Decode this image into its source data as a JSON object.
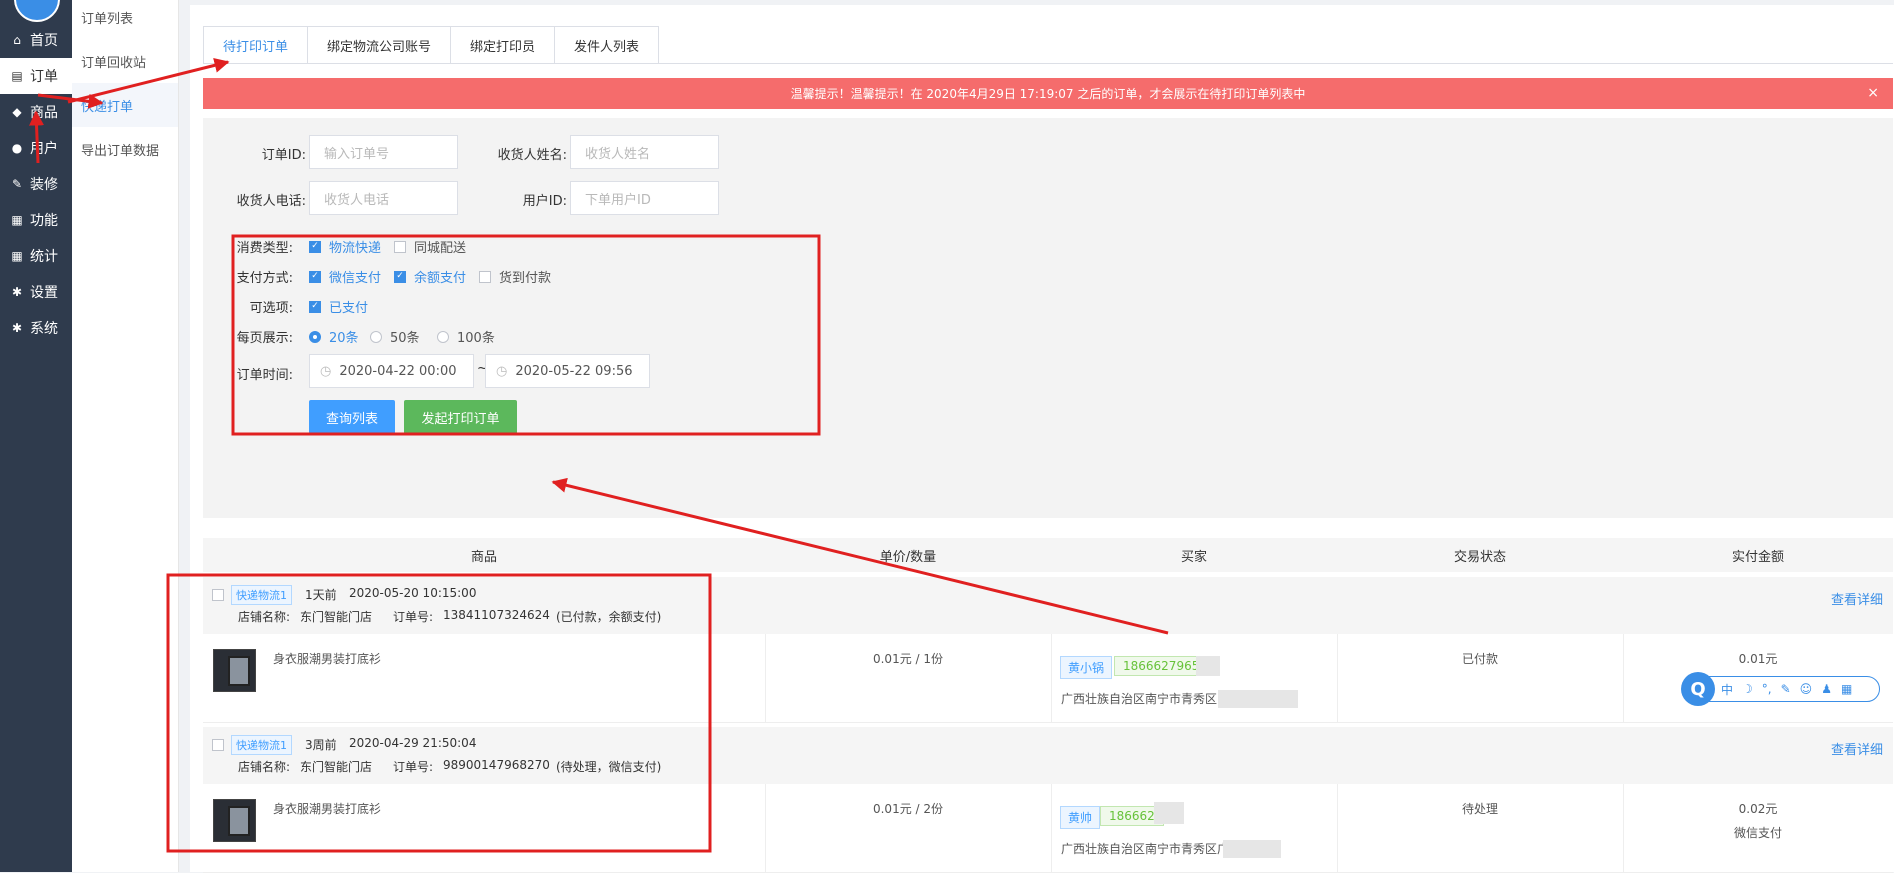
{
  "nav": {
    "items": [
      {
        "icon": "home-icon",
        "label": "首页"
      },
      {
        "icon": "order-icon",
        "label": "订单",
        "active": true
      },
      {
        "icon": "bag-icon",
        "label": "商品"
      },
      {
        "icon": "user-icon",
        "label": "用户"
      },
      {
        "icon": "paint-icon",
        "label": "装修"
      },
      {
        "icon": "grid-icon",
        "label": "功能"
      },
      {
        "icon": "grid-icon",
        "label": "统计"
      },
      {
        "icon": "gear-icon",
        "label": "设置"
      },
      {
        "icon": "gear-icon",
        "label": "系统"
      }
    ]
  },
  "subnav": {
    "items": [
      "订单列表",
      "订单回收站",
      "快递打单",
      "导出订单数据"
    ],
    "active_index": 2
  },
  "tabs": [
    "待打印订单",
    "绑定物流公司账号",
    "绑定打印员",
    "发件人列表"
  ],
  "active_tab": 0,
  "alert": {
    "text": "温馨提示！温馨提示！在 2020年4月29日 17:19:07 之后的订单，才会展示在待打印订单列表中",
    "close": "×"
  },
  "filters": {
    "order_id": {
      "label": "订单ID:",
      "placeholder": "输入订单号"
    },
    "receiver_name": {
      "label": "收货人姓名:",
      "placeholder": "收货人姓名"
    },
    "receiver_phone": {
      "label": "收货人电话:",
      "placeholder": "收货人电话"
    },
    "user_id": {
      "label": "用户ID:",
      "placeholder": "下单用户ID"
    },
    "consume_type": {
      "label": "消费类型:",
      "options": [
        {
          "text": "物流快递",
          "checked": true
        },
        {
          "text": "同城配送",
          "checked": false
        }
      ]
    },
    "pay_method": {
      "label": "支付方式:",
      "options": [
        {
          "text": "微信支付",
          "checked": true
        },
        {
          "text": "余额支付",
          "checked": true
        },
        {
          "text": "货到付款",
          "checked": false
        }
      ]
    },
    "optional": {
      "label": "可选项:",
      "options": [
        {
          "text": "已支付",
          "checked": true
        }
      ]
    },
    "per_page": {
      "label": "每页展示:",
      "options": [
        {
          "text": "20条",
          "checked": true
        },
        {
          "text": "50条",
          "checked": false
        },
        {
          "text": "100条",
          "checked": false
        }
      ]
    },
    "order_time": {
      "label": "订单时间:",
      "start": "2020-04-22 00:00",
      "end": "2020-05-22 09:56",
      "sep": "~"
    },
    "query_button": "查询列表",
    "print_button": "发起打印订单"
  },
  "table": {
    "headers": [
      "商品",
      "单价/数量",
      "买家",
      "交易状态",
      "实付金额"
    ],
    "orders": [
      {
        "tag": "快递物流1",
        "ago": "1天前",
        "time": "2020-05-20 10:15:00",
        "store_label": "店铺名称:",
        "store": "东门智能门店",
        "no_label": "订单号:",
        "no": "13841107324624",
        "pay_info": "(已付款，余额支付)",
        "product": "身衣服潮男装打底衫",
        "price_qty": "0.01元 / 1份",
        "buyer_name": "黄小锅",
        "buyer_phone": "1866627965",
        "address": "广西壮族自治区南宁市青秀区",
        "status": "已付款",
        "amount": "0.01元",
        "pay": "余额支付",
        "detail": "查看详细"
      },
      {
        "tag": "快递物流1",
        "ago": "3周前",
        "time": "2020-04-29 21:50:04",
        "store_label": "店铺名称:",
        "store": "东门智能门店",
        "no_label": "订单号:",
        "no": "98900147968270",
        "pay_info": "(待处理，微信支付)",
        "product": "身衣服潮男装打底衫",
        "price_qty": "0.01元 / 2份",
        "buyer_name": "黄帅",
        "buyer_phone": "186662",
        "address": "广西壮族自治区南宁市青秀区广",
        "status": "待处理",
        "amount": "0.02元",
        "pay": "微信支付",
        "detail": "查看详细"
      }
    ]
  },
  "ime": {
    "q": "Q",
    "items": [
      "中",
      "☽",
      "°,",
      "✎",
      "☺",
      "♟",
      "▦"
    ]
  },
  "colors": {
    "accent": "#3a8ee6",
    "alert": "#f56c6c",
    "green_btn": "#5cb85c",
    "annotation": "#e02020",
    "nav_bg": "#2f3b4d"
  }
}
